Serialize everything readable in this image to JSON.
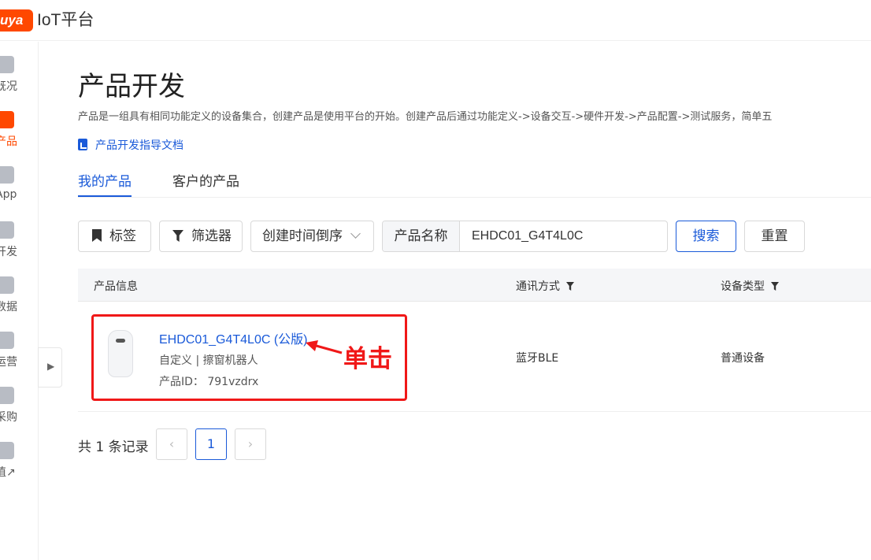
{
  "topbar": {
    "logo_text": "uya",
    "app_title": "IoT平台"
  },
  "sidebar": {
    "items": [
      {
        "label": "既况",
        "icon": "home-icon"
      },
      {
        "label": "产品",
        "icon": "product-icon",
        "active": true
      },
      {
        "label": "App",
        "icon": "phone-icon"
      },
      {
        "label": "开发",
        "icon": "cloud-icon"
      },
      {
        "label": "数据",
        "icon": "chart-icon"
      },
      {
        "label": "运营",
        "icon": "star-icon"
      },
      {
        "label": "采购",
        "icon": "box-icon"
      },
      {
        "label": "值↗",
        "icon": "value-icon"
      }
    ]
  },
  "page": {
    "title": "产品开发",
    "description": "产品是一组具有相同功能定义的设备集合，创建产品是使用平台的开始。创建产品后通过功能定义->设备交互->硬件开发->产品配置->测试服务，简单五",
    "doc_link": "产品开发指导文档"
  },
  "tabs": [
    {
      "label": "我的产品",
      "active": true
    },
    {
      "label": "客户的产品",
      "active": false
    }
  ],
  "filters": {
    "tag_label": "标签",
    "filter_label": "筛选器",
    "sort_label": "创建时间倒序",
    "search_addon": "产品名称",
    "search_value": "EHDC01_G4T4L0C",
    "search_button": "搜索",
    "reset_button": "重置"
  },
  "table": {
    "headers": {
      "info": "产品信息",
      "comm": "通讯方式",
      "type": "设备类型"
    },
    "rows": [
      {
        "name": "EHDC01_G4T4L0C (公版)",
        "meta": "自定义  |  擦窗机器人",
        "product_id": "产品ID：  791vzdrx",
        "comm": "蓝牙BLE",
        "device_type": "普通设备"
      }
    ]
  },
  "annotation": {
    "text": "单击",
    "color": "#f01818"
  },
  "pagination": {
    "total_text": "共 1 条记录",
    "current_page": "1",
    "prev": "‹",
    "next": "›"
  },
  "colors": {
    "brand": "#ff4800",
    "accent": "#1a5ad9"
  }
}
